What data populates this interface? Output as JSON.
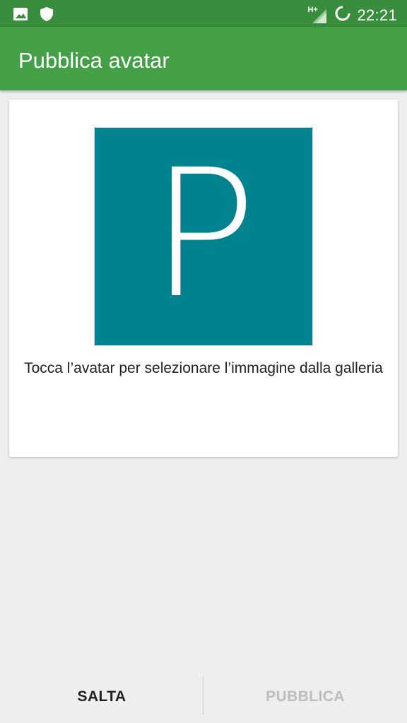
{
  "status_bar": {
    "time": "22:21",
    "network_label": "H+",
    "icons": [
      "gallery-icon",
      "shield-icon",
      "signal-icon",
      "loading-icon"
    ]
  },
  "app_bar": {
    "title": "Pubblica avatar",
    "color": "#43a047"
  },
  "avatar": {
    "letter": "P",
    "color": "#00838f"
  },
  "hint": "Tocca l’avatar per selezionare l’immagine dalla galleria",
  "actions": {
    "skip_label": "SALTA",
    "publish_label": "PUBBLICA",
    "publish_enabled": false
  }
}
